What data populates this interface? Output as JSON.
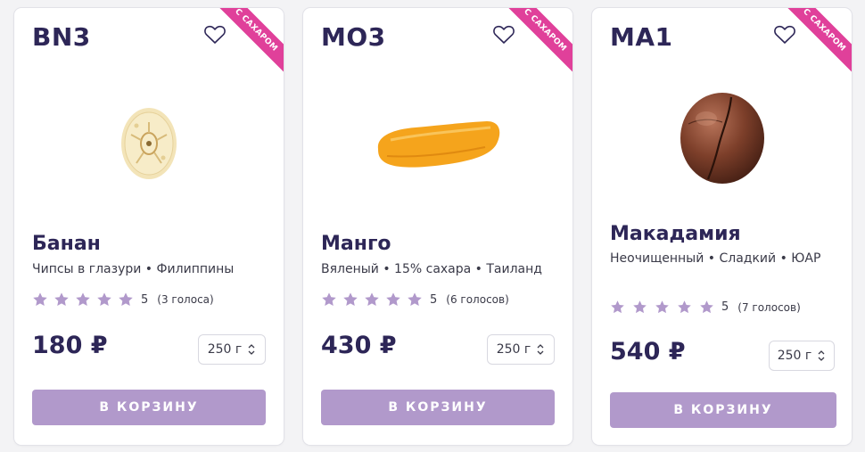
{
  "colors": {
    "heading": "#2d2657",
    "button": "#b199cb",
    "ribbon": "#e0409a",
    "star": "#b199cb"
  },
  "products": [
    {
      "code": "BN3",
      "ribbon": "С САХАРОМ",
      "name": "Банан",
      "description": "Чипсы в глазури • Филиппины",
      "rating_stars": 5,
      "score": "5",
      "votes": "(3 голоса)",
      "price": "180 ₽",
      "weight": "250 г",
      "cart_label": "В КОРЗИНУ",
      "image_icon": "banana-chip-image"
    },
    {
      "code": "MO3",
      "ribbon": "С САХАРОМ",
      "name": "Манго",
      "description": "Вяленый • 15% сахара • Таиланд",
      "rating_stars": 5,
      "score": "5",
      "votes": "(6 голосов)",
      "price": "430 ₽",
      "weight": "250 г",
      "cart_label": "В КОРЗИНУ",
      "image_icon": "dried-mango-image"
    },
    {
      "code": "MA1",
      "ribbon": "С САХАРОМ",
      "name": "Макадамия",
      "description": "Неочищенный • Сладкий • ЮАР",
      "rating_stars": 5,
      "score": "5",
      "votes": "(7 голосов)",
      "price": "540 ₽",
      "weight": "250 г",
      "cart_label": "В КОРЗИНУ",
      "image_icon": "macadamia-nut-image"
    }
  ]
}
